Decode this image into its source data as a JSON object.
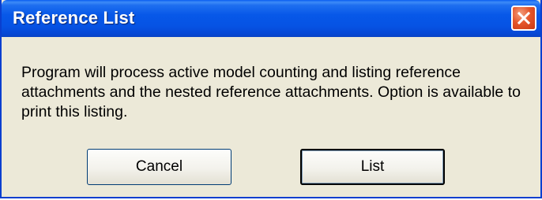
{
  "dialog": {
    "title": "Reference List",
    "close_icon": "close-x-icon",
    "message": "Program will process active model counting and listing reference attachments and the nested reference attachments.  Option is available to print this listing.",
    "buttons": {
      "cancel_label": "Cancel",
      "list_label": "List"
    }
  },
  "colors": {
    "titlebar": "#0653e4",
    "dialog_background": "#ece9d8",
    "close_button": "#e5562b",
    "title_text": "#ffffff"
  }
}
